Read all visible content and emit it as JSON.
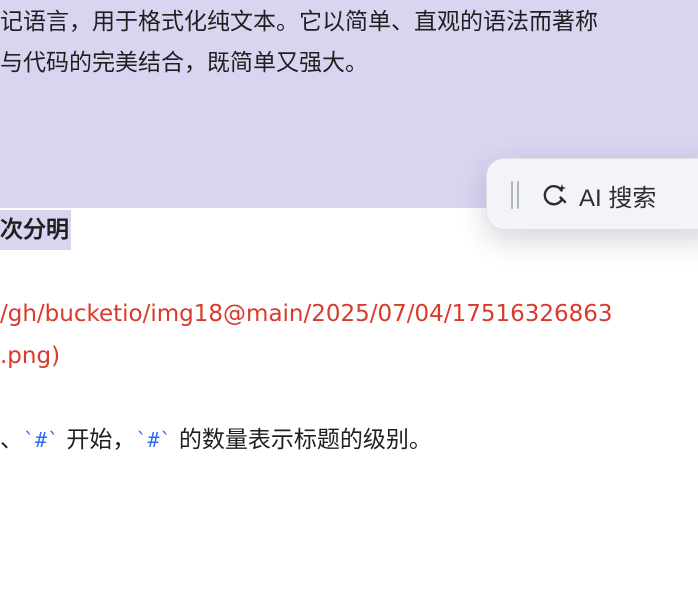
{
  "document": {
    "line1": "记语言，用于格式化纯文本。它以简单、直观的语法而著称",
    "line2": "与代码的完美结合，既简单又强大。",
    "heading": "次分明",
    "url_line1": "/gh/bucketio/img18@main/2025/07/04/17516326863",
    "url_line2": ".png)",
    "body_prefix": "、",
    "code1": "`#`",
    "body_mid": " 开始，",
    "code2": "`#`",
    "body_suffix": " 的数量表示标题的级别。"
  },
  "toolbar": {
    "drag_handle_icon": "drag-handle-icon",
    "ai_search_icon": "ai-sparkle-search-icon",
    "ai_search_label": "AI 搜索"
  },
  "colors": {
    "selection": "#d8d5f0",
    "link_red": "#d93a2b",
    "code_blue": "#2f6df2",
    "toolbar_bg": "#f3f4f7"
  }
}
